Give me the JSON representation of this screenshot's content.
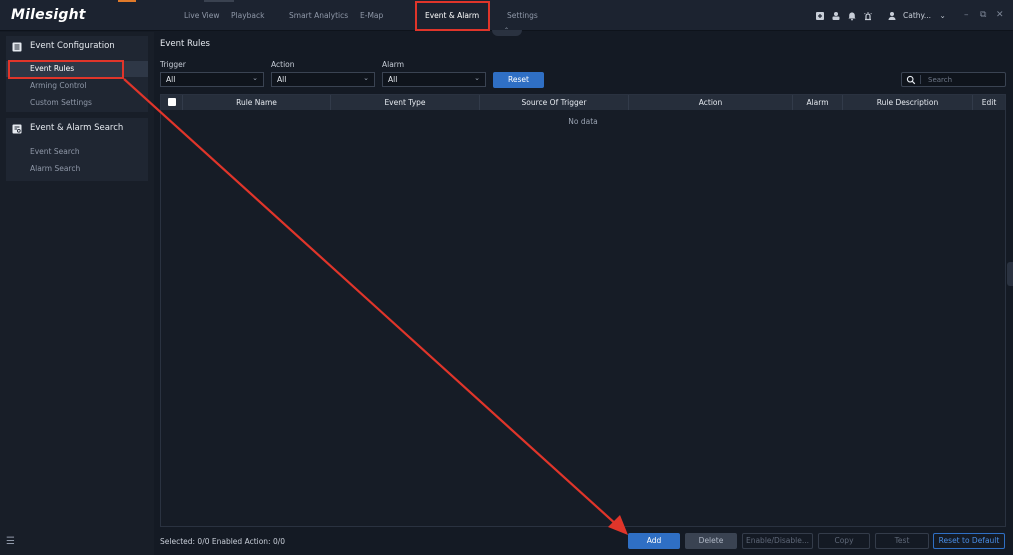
{
  "app": {
    "logo": "Milesight"
  },
  "nav": {
    "tabs": [
      "Live View",
      "Playback",
      "Smart Analytics",
      "E-Map",
      "Event & Alarm",
      "Settings"
    ],
    "active_index": 4
  },
  "topbar": {
    "user": "Cathy...",
    "icons": [
      "plus-box-icon",
      "user-download-icon",
      "bell-icon",
      "alert-icon",
      "user-icon",
      "minimize-icon",
      "restore-icon",
      "close-icon"
    ]
  },
  "sidebar": {
    "sections": [
      {
        "title": "Event Configuration",
        "items": [
          "Event Rules",
          "Arming Control",
          "Custom Settings"
        ]
      },
      {
        "title": "Event & Alarm Search",
        "items": [
          "Event Search",
          "Alarm Search"
        ]
      }
    ],
    "active_item": "Event Rules"
  },
  "main": {
    "title": "Event Rules",
    "filters": [
      {
        "label": "Trigger",
        "value": "All"
      },
      {
        "label": "Action",
        "value": "All"
      },
      {
        "label": "Alarm",
        "value": "All"
      }
    ],
    "reset_label": "Reset",
    "search_placeholder": "Search"
  },
  "table": {
    "columns": [
      "Rule Name",
      "Event Type",
      "Source Of Trigger",
      "Action",
      "Alarm",
      "Rule Description",
      "Edit"
    ],
    "empty_text": "No data"
  },
  "footer": {
    "status": "Selected: 0/0  Enabled Action: 0/0",
    "buttons": [
      "Add",
      "Delete",
      "Enable/Disable...",
      "Copy",
      "Test",
      "Reset to Default"
    ]
  },
  "colors": {
    "accent_blue": "#2f6fc4",
    "highlight_red": "#e0352a",
    "background": "#141a24"
  }
}
